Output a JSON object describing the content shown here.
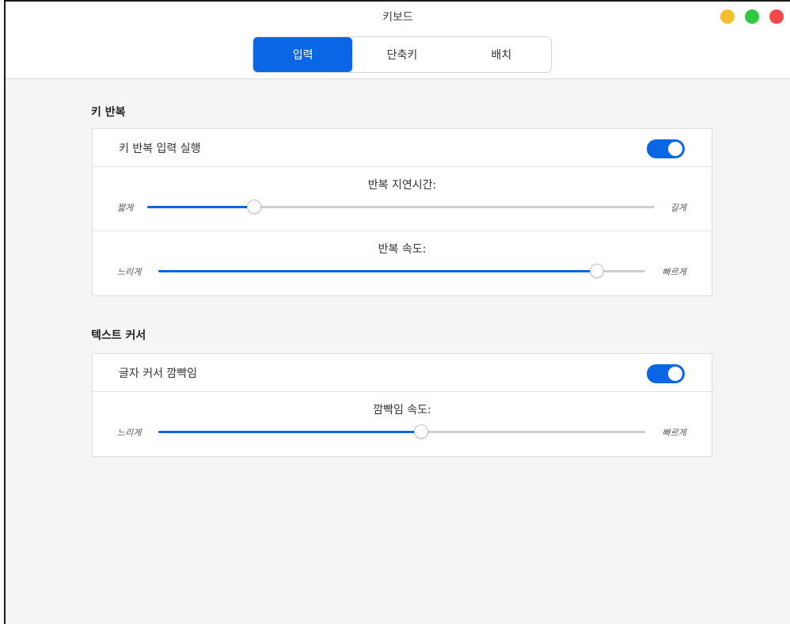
{
  "window": {
    "title": "키보드"
  },
  "tabs": [
    {
      "label": "입력",
      "active": true
    },
    {
      "label": "단축키",
      "active": false
    },
    {
      "label": "배치",
      "active": false
    }
  ],
  "sections": {
    "key_repeat": {
      "title": "키 반복",
      "toggle": {
        "label": "키 반복 입력 실행",
        "on": true
      },
      "delay": {
        "title": "반복 지연시간:",
        "min_label": "짧게",
        "max_label": "길게",
        "value": 0.21
      },
      "rate": {
        "title": "반복 속도:",
        "min_label": "느리게",
        "max_label": "빠르게",
        "value": 0.9
      }
    },
    "cursor": {
      "title": "텍스트 커서",
      "toggle": {
        "label": "글자 커서 깜빡임",
        "on": true
      },
      "blink": {
        "title": "깜빡임 속도:",
        "min_label": "느리게",
        "max_label": "빠르게",
        "value": 0.54
      }
    }
  },
  "colors": {
    "accent": "#0a66e4",
    "traffic_yellow": "#f6be2d",
    "traffic_green": "#2fc940",
    "traffic_red": "#f2484a"
  }
}
